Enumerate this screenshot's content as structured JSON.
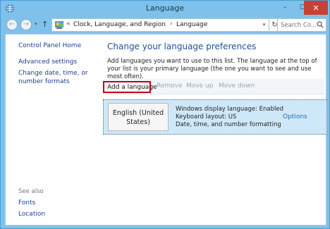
{
  "window": {
    "title": "Language",
    "controls": {
      "minimize": "–",
      "maximize": "☐",
      "close": "✕"
    }
  },
  "address": {
    "crumbs": [
      "Clock, Language, and Region",
      "Language"
    ],
    "separator": "›",
    "overflow": "«",
    "search_placeholder": "Search Co..."
  },
  "sidebar": {
    "home": "Control Panel Home",
    "advanced": "Advanced settings",
    "date_formats": "Change date, time, or number formats",
    "see_also": "See also",
    "fonts": "Fonts",
    "location": "Location"
  },
  "main": {
    "heading": "Change your language preferences",
    "description": "Add languages you want to use to this list. The language at the top of your list is your primary language (the one you want to see and use most often).",
    "toolbar": {
      "add": "Add a language",
      "remove": "Remove",
      "move_up": "Move up",
      "move_down": "Move down"
    },
    "languages": [
      {
        "name": "English (United States)",
        "display": "Windows display language: Enabled",
        "keyboard": "Keyboard layout: US",
        "formatting": "Date, time, and number formatting",
        "options": "Options"
      }
    ]
  },
  "colors": {
    "link": "#1c3f8f",
    "heading": "#1f4f9c",
    "selection": "#cfe8f8",
    "highlight_border": "#c0001a"
  }
}
